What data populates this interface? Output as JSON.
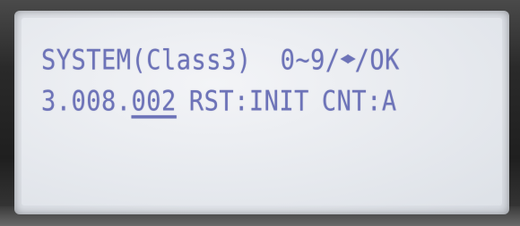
{
  "display": {
    "line1": {
      "mode": "SYSTEM(Class3)",
      "keys_range": "0~9/",
      "arrows_glyph": "◀▶",
      "keys_ok": "/OK"
    },
    "line2": {
      "version_prefix": "3.008.",
      "version_cursor": "002",
      "rst": "RST:INIT",
      "cnt": "CNT:A"
    }
  },
  "colors": {
    "lcd_text": "#6d73b8",
    "lcd_background": "#e6e9ee",
    "bezel": "#2a2a2a"
  }
}
